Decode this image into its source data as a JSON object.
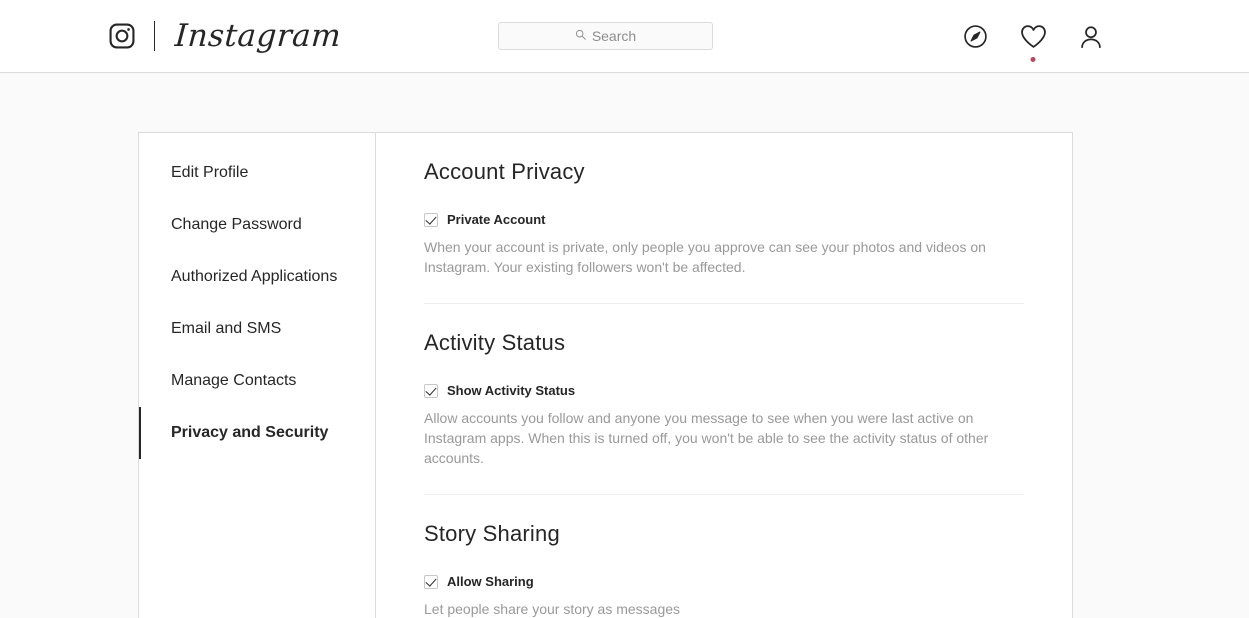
{
  "header": {
    "brand_name": "Instagram",
    "camera_icon": "instagram-camera-icon",
    "search": {
      "placeholder": "Search",
      "value": "",
      "icon": "search-icon"
    },
    "nav": [
      {
        "name": "explore",
        "icon": "compass-icon",
        "has_notification": false
      },
      {
        "name": "activity",
        "icon": "heart-icon",
        "has_notification": true
      },
      {
        "name": "profile",
        "icon": "person-icon",
        "has_notification": false
      }
    ],
    "notification_dot_color": "#b5485e"
  },
  "sidebar": {
    "items": [
      {
        "label": "Edit Profile",
        "active": false
      },
      {
        "label": "Change Password",
        "active": false
      },
      {
        "label": "Authorized Applications",
        "active": false
      },
      {
        "label": "Email and SMS",
        "active": false
      },
      {
        "label": "Manage Contacts",
        "active": false
      },
      {
        "label": "Privacy and Security",
        "active": true
      }
    ]
  },
  "main": {
    "sections": [
      {
        "title": "Account Privacy",
        "checkbox_label": "Private Account",
        "checked": true,
        "description": "When your account is private, only people you approve can see your photos and videos on Instagram. Your existing followers won't be affected."
      },
      {
        "title": "Activity Status",
        "checkbox_label": "Show Activity Status",
        "checked": true,
        "description": "Allow accounts you follow and anyone you message to see when you were last active on Instagram apps. When this is turned off, you won't be able to see the activity status of other accounts."
      },
      {
        "title": "Story Sharing",
        "checkbox_label": "Allow Sharing",
        "checked": true,
        "description": "Let people share your story as messages"
      }
    ]
  },
  "colors": {
    "page_background": "#fafafa",
    "card_background": "#ffffff",
    "border": "#dbdbdb",
    "text_primary": "#262626",
    "text_secondary": "#999999",
    "accent": "#b5485e"
  }
}
